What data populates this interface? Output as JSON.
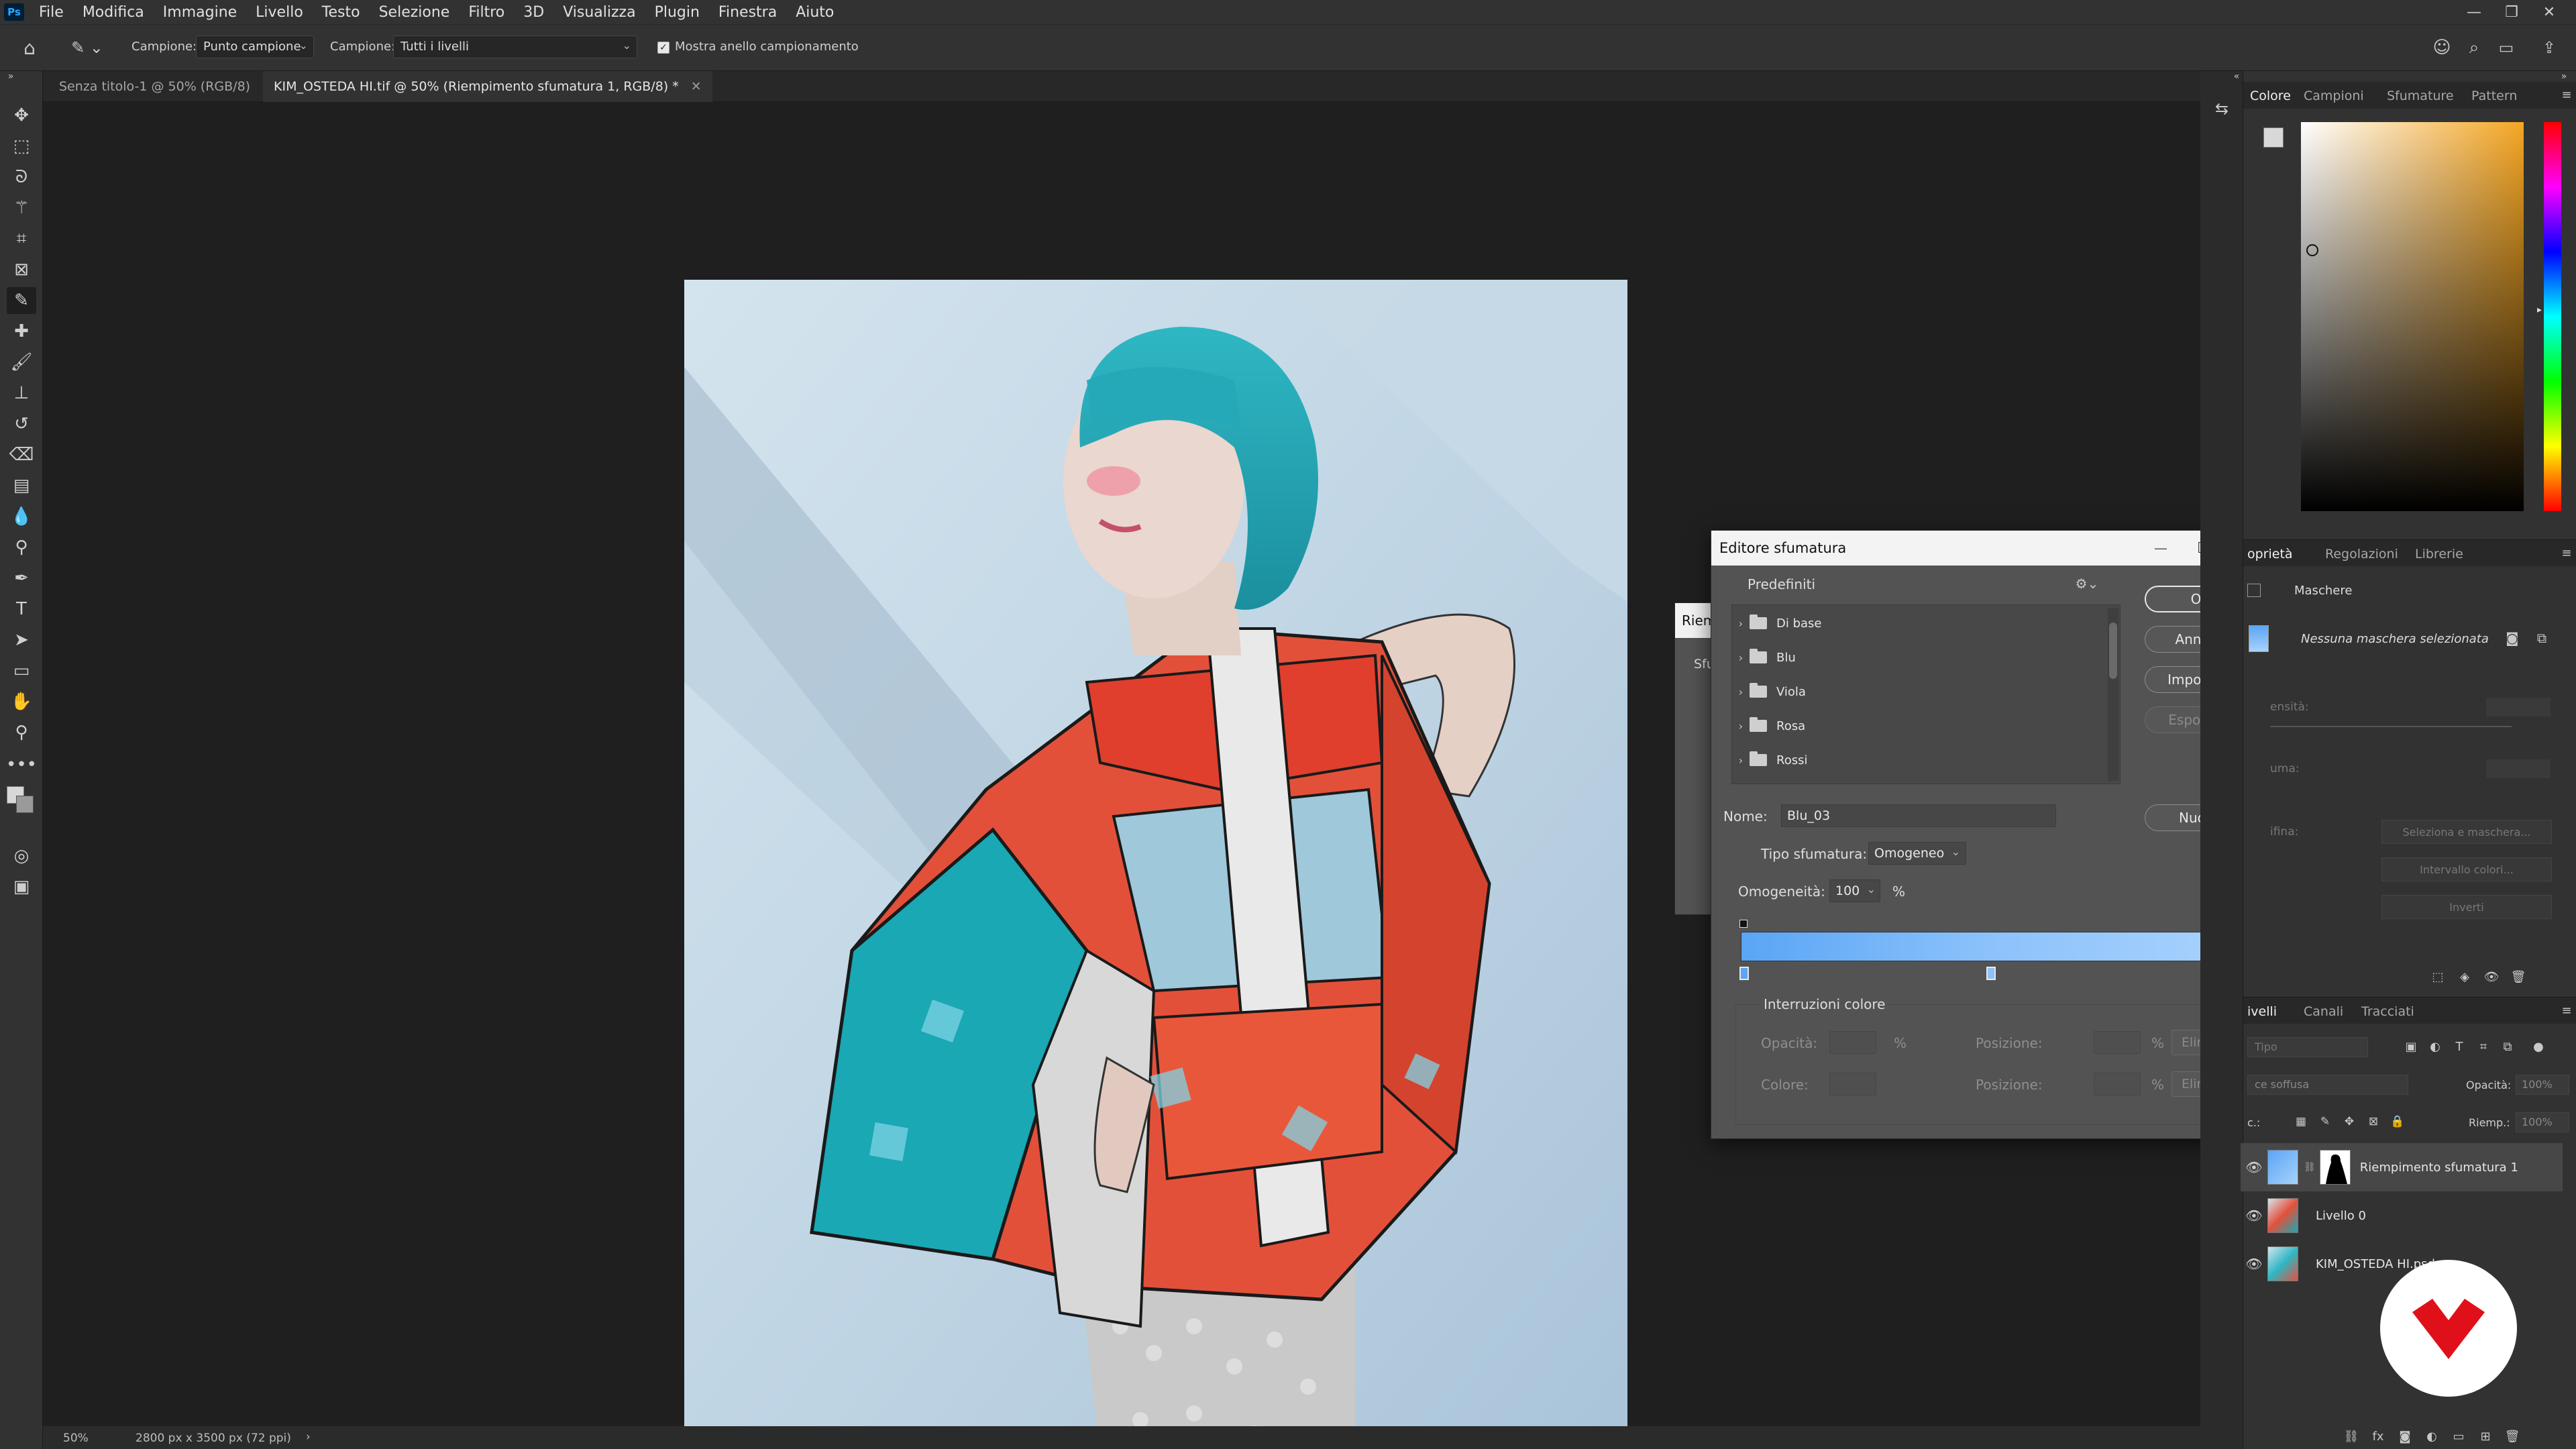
{
  "app": {
    "logo": "Ps",
    "menu": [
      "File",
      "Modifica",
      "Immagine",
      "Livello",
      "Testo",
      "Selezione",
      "Filtro",
      "3D",
      "Visualizza",
      "Plugin",
      "Finestra",
      "Aiuto"
    ]
  },
  "options_bar": {
    "sample_label": "Campione:",
    "sample_value": "Punto campione",
    "sample2_label": "Campione:",
    "sample2_value": "Tutti i livelli",
    "ring_label": "Mostra anello campionamento"
  },
  "tabs": [
    {
      "label": "Senza titolo-1 @ 50% (RGB/8)"
    },
    {
      "label": "KIM_OSTEDA HI.tif @ 50% (Riempimento sfumatura 1, RGB/8) *"
    }
  ],
  "status": {
    "zoom": "50%",
    "doc_size": "2800 px x 3500 px (72 ppi)",
    "arrow": "›"
  },
  "bg_dialog": {
    "title": "Riem",
    "label": "Sfu"
  },
  "gradient_editor": {
    "title": "Editore sfumatura",
    "presets_label": "Predefiniti",
    "presets": [
      "Di base",
      "Blu",
      "Viola",
      "Rosa",
      "Rossi"
    ],
    "buttons": {
      "ok": "OK",
      "cancel": "Annulla",
      "import": "Importa...",
      "export": "Esporta...",
      "new": "Nuovo"
    },
    "name_label": "Nome:",
    "name_value": "Blu_03",
    "type_label": "Tipo sfumatura:",
    "type_value": "Omogeneo",
    "smooth_label": "Omogeneità:",
    "smooth_value": "100",
    "smooth_unit": "%",
    "stops_label": "Interruzioni colore",
    "opacity_label": "Opacità:",
    "opacity_unit": "%",
    "position_label": "Posizione:",
    "position_unit": "%",
    "delete_label": "Elimina",
    "color_label": "Colore:",
    "colors": {
      "start": "#5aa5f5",
      "mid": "#8cc2fb",
      "end": "#a8d2fc"
    }
  },
  "color_panel": {
    "tabs": [
      "Colore",
      "Campioni",
      "Sfumature",
      "Pattern"
    ],
    "hue_color": "#f5a623"
  },
  "properties_panel": {
    "tabs": [
      "oprietà",
      "Regolazioni",
      "Librerie"
    ],
    "masks_label": "Maschere",
    "no_mask": "Nessuna maschera selezionata",
    "density": "ensità:",
    "feather": "uma:",
    "refine": "ifina:",
    "select_mask": "Seleziona e maschera...",
    "color_range": "Intervallo colori...",
    "invert": "Inverti"
  },
  "layers_panel": {
    "tabs": [
      "ivelli",
      "Canali",
      "Tracciati"
    ],
    "kind_label": "Tipo",
    "blend_mode": "ce soffusa",
    "opacity_label": "Opacità:",
    "opacity_value": "100%",
    "lock_label": "c.:",
    "fill_label": "Riemp.:",
    "fill_value": "100%",
    "layers": [
      "Riempimento sfumatura 1",
      "Livello 0",
      "KIM_OSTEDA HI.psd"
    ]
  }
}
